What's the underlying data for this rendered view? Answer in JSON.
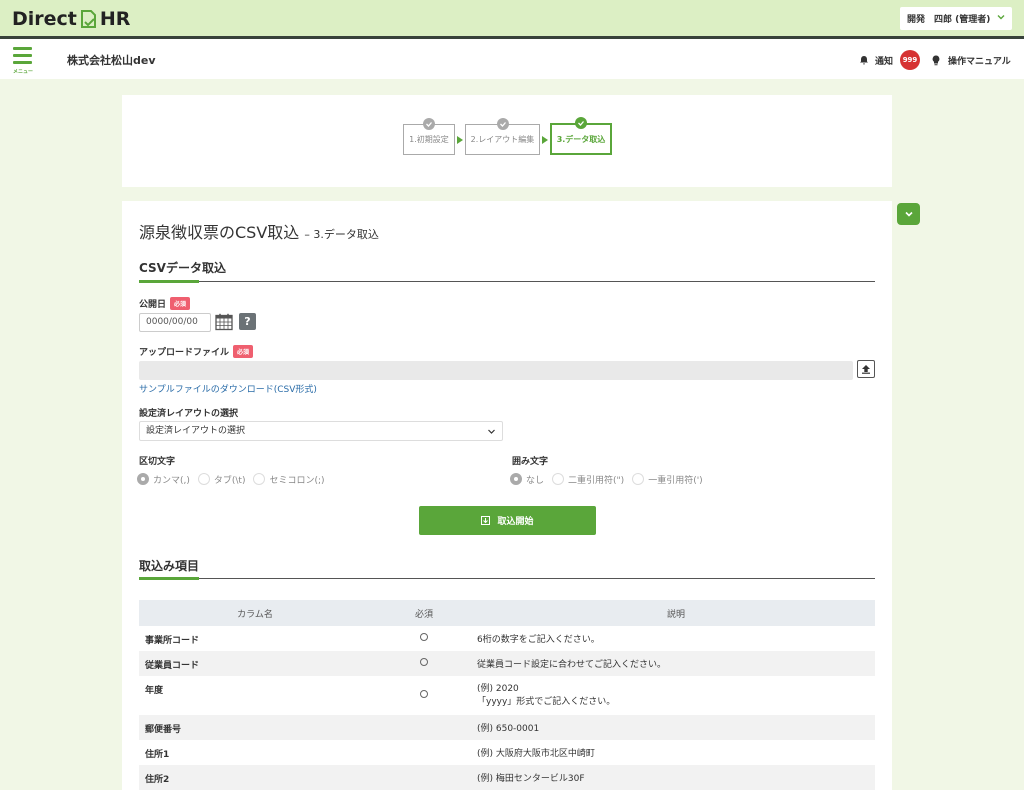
{
  "app": {
    "logo_text_left": "Direct",
    "logo_text_right": "HR",
    "user_label": "開発　四郎 (管理者)",
    "accent_color": "#5aa63a"
  },
  "header": {
    "menu_label": "メニュー",
    "company": "株式会社松山dev",
    "notify_label": "通知",
    "notify_count": "999",
    "manual_label": "操作マニュアル"
  },
  "steps": [
    {
      "label": "1.初期設定",
      "state": "done"
    },
    {
      "label": "2.レイアウト編集",
      "state": "done"
    },
    {
      "label": "3.データ取込",
      "state": "active"
    }
  ],
  "page": {
    "title": "源泉徴収票のCSV取込",
    "subtitle": "– 3.データ取込"
  },
  "csv_section": {
    "title": "CSVデータ取込",
    "required_badge": "必須",
    "publish_date_label": "公開日",
    "publish_date_value": "0000/00/00",
    "help_label": "?",
    "upload_label": "アップロードファイル",
    "sample_link": "サンプルファイルのダウンロード(CSV形式)",
    "layout_label": "設定済レイアウトの選択",
    "layout_selected": "設定済レイアウトの選択",
    "delimiter_label": "区切文字",
    "delimiter_options": [
      "カンマ(,)",
      "タブ(\\t)",
      "セミコロン(;)"
    ],
    "delimiter_selected": 0,
    "quote_label": "囲み文字",
    "quote_options": [
      "なし",
      "二重引用符(\")",
      "一重引用符(')"
    ],
    "quote_selected": 0,
    "start_button": "取込開始"
  },
  "items_section": {
    "title": "取込み項目",
    "columns": [
      "カラム名",
      "必須",
      "説明"
    ],
    "rows": [
      {
        "name": "事業所コード",
        "required": true,
        "desc": [
          "6桁の数字をご記入ください。"
        ]
      },
      {
        "name": "従業員コード",
        "required": true,
        "desc": [
          "従業員コード設定に合わせてご記入ください。"
        ]
      },
      {
        "name": "年度",
        "required": true,
        "desc": [
          "(例) 2020",
          "「yyyy」形式でご記入ください。"
        ]
      },
      {
        "name": "郵便番号",
        "required": false,
        "desc": [
          "(例) 650-0001"
        ]
      },
      {
        "name": "住所1",
        "required": false,
        "desc": [
          "(例) 大阪府大阪市北区中崎町"
        ]
      },
      {
        "name": "住所2",
        "required": false,
        "desc": [
          "(例) 梅田センタービル30F"
        ]
      }
    ]
  }
}
